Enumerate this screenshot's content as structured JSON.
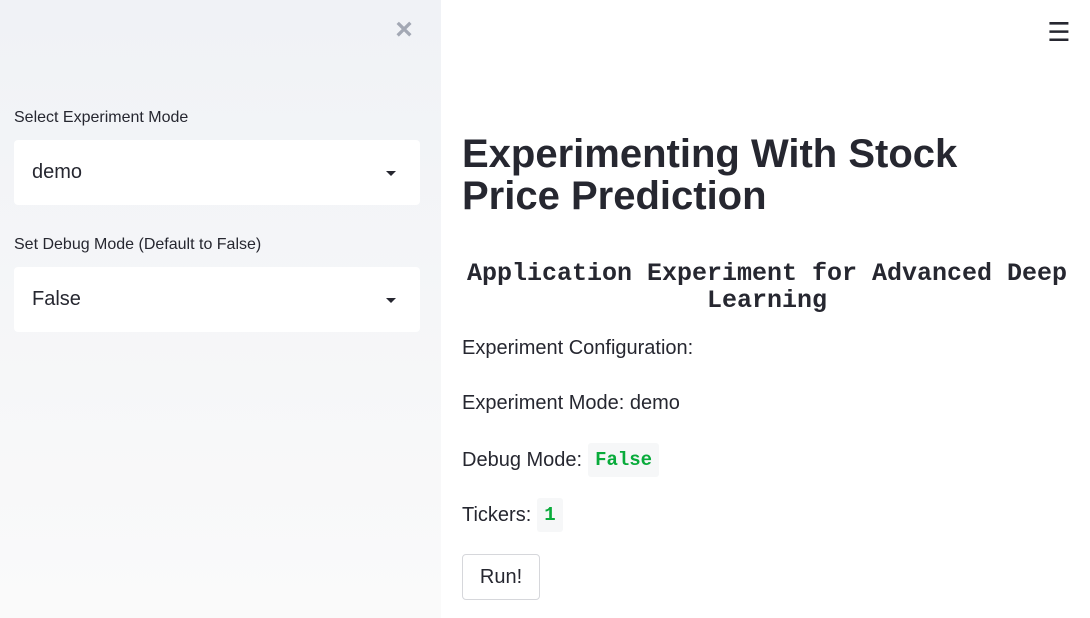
{
  "sidebar": {
    "close_symbol": "×",
    "experiment_mode": {
      "label": "Select Experiment Mode",
      "value": "demo"
    },
    "debug_mode": {
      "label": "Set Debug Mode (Default to False)",
      "value": "False"
    }
  },
  "header": {
    "menu_symbol": "☰"
  },
  "main": {
    "title": "Experimenting With Stock Price Prediction",
    "subtitle": "Application Experiment for Advanced Deep Learning",
    "config_heading": "Experiment Configuration:",
    "experiment_mode_text": "Experiment Mode: demo",
    "debug_mode_label": "Debug Mode:",
    "debug_mode_value": "False",
    "tickers_label": "Tickers:",
    "tickers_value": "1",
    "run_button": "Run!"
  },
  "colors": {
    "sidebar_bg": "#f0f2f6",
    "text": "#262730",
    "code_text": "#09ab3b",
    "code_bg": "#f6f7f8"
  }
}
